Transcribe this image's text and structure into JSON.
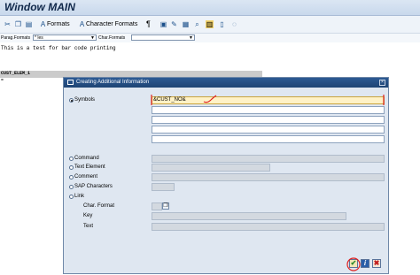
{
  "window": {
    "title": "Window MAIN"
  },
  "toolbar": {
    "formats_label": "Formats",
    "char_formats_label": "Character Formats",
    "pilcrow": "¶"
  },
  "subbar": {
    "para_label": "Parag.Formats",
    "para_value": "* les",
    "char_label": "Char.Formats",
    "char_value": ""
  },
  "editor": {
    "line1": "This is a test for bar code printing",
    "band_text": "CUST_ELEM_1",
    "eq": "="
  },
  "dialog": {
    "title": "Creating Additional Information",
    "close": "×",
    "options": {
      "symbols": "Symbols",
      "command": "Command",
      "text_element": "Text Element",
      "comment": "Comment",
      "sap_characters": "SAP Characters",
      "link": "Link"
    },
    "symbols_value": "&CUST_NO&",
    "link_fields": {
      "char_format": "Char. Format",
      "key": "Key",
      "text": "Text"
    },
    "buttons": {
      "ok": "✔",
      "info": "i",
      "cancel": "✖"
    }
  },
  "colors": {
    "annotation": "#e0201f",
    "dialog_title": "#2d5a93",
    "highlight": "#fff2c6"
  }
}
